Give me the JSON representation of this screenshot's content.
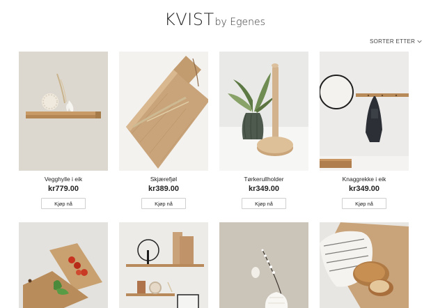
{
  "brand": {
    "main": "KVIST",
    "sub": "by Egenes"
  },
  "sort": {
    "label": "SORTER ETTER",
    "icon": "chevron-down-icon"
  },
  "products_row1": [
    {
      "name": "Vegghylle i eik",
      "price": "kr779.00",
      "button": "Kjøp nå"
    },
    {
      "name": "Skjærefjøl",
      "price": "kr389.00",
      "button": "Kjøp nå"
    },
    {
      "name": "Tørkerullholder",
      "price": "kr349.00",
      "button": "Kjøp nå"
    },
    {
      "name": "Knaggrekke i eik",
      "price": "kr349.00",
      "button": "Kjøp nå"
    }
  ],
  "colors": {
    "text": "#222222",
    "button_border": "#cfcfcf",
    "background": "#ffffff"
  }
}
